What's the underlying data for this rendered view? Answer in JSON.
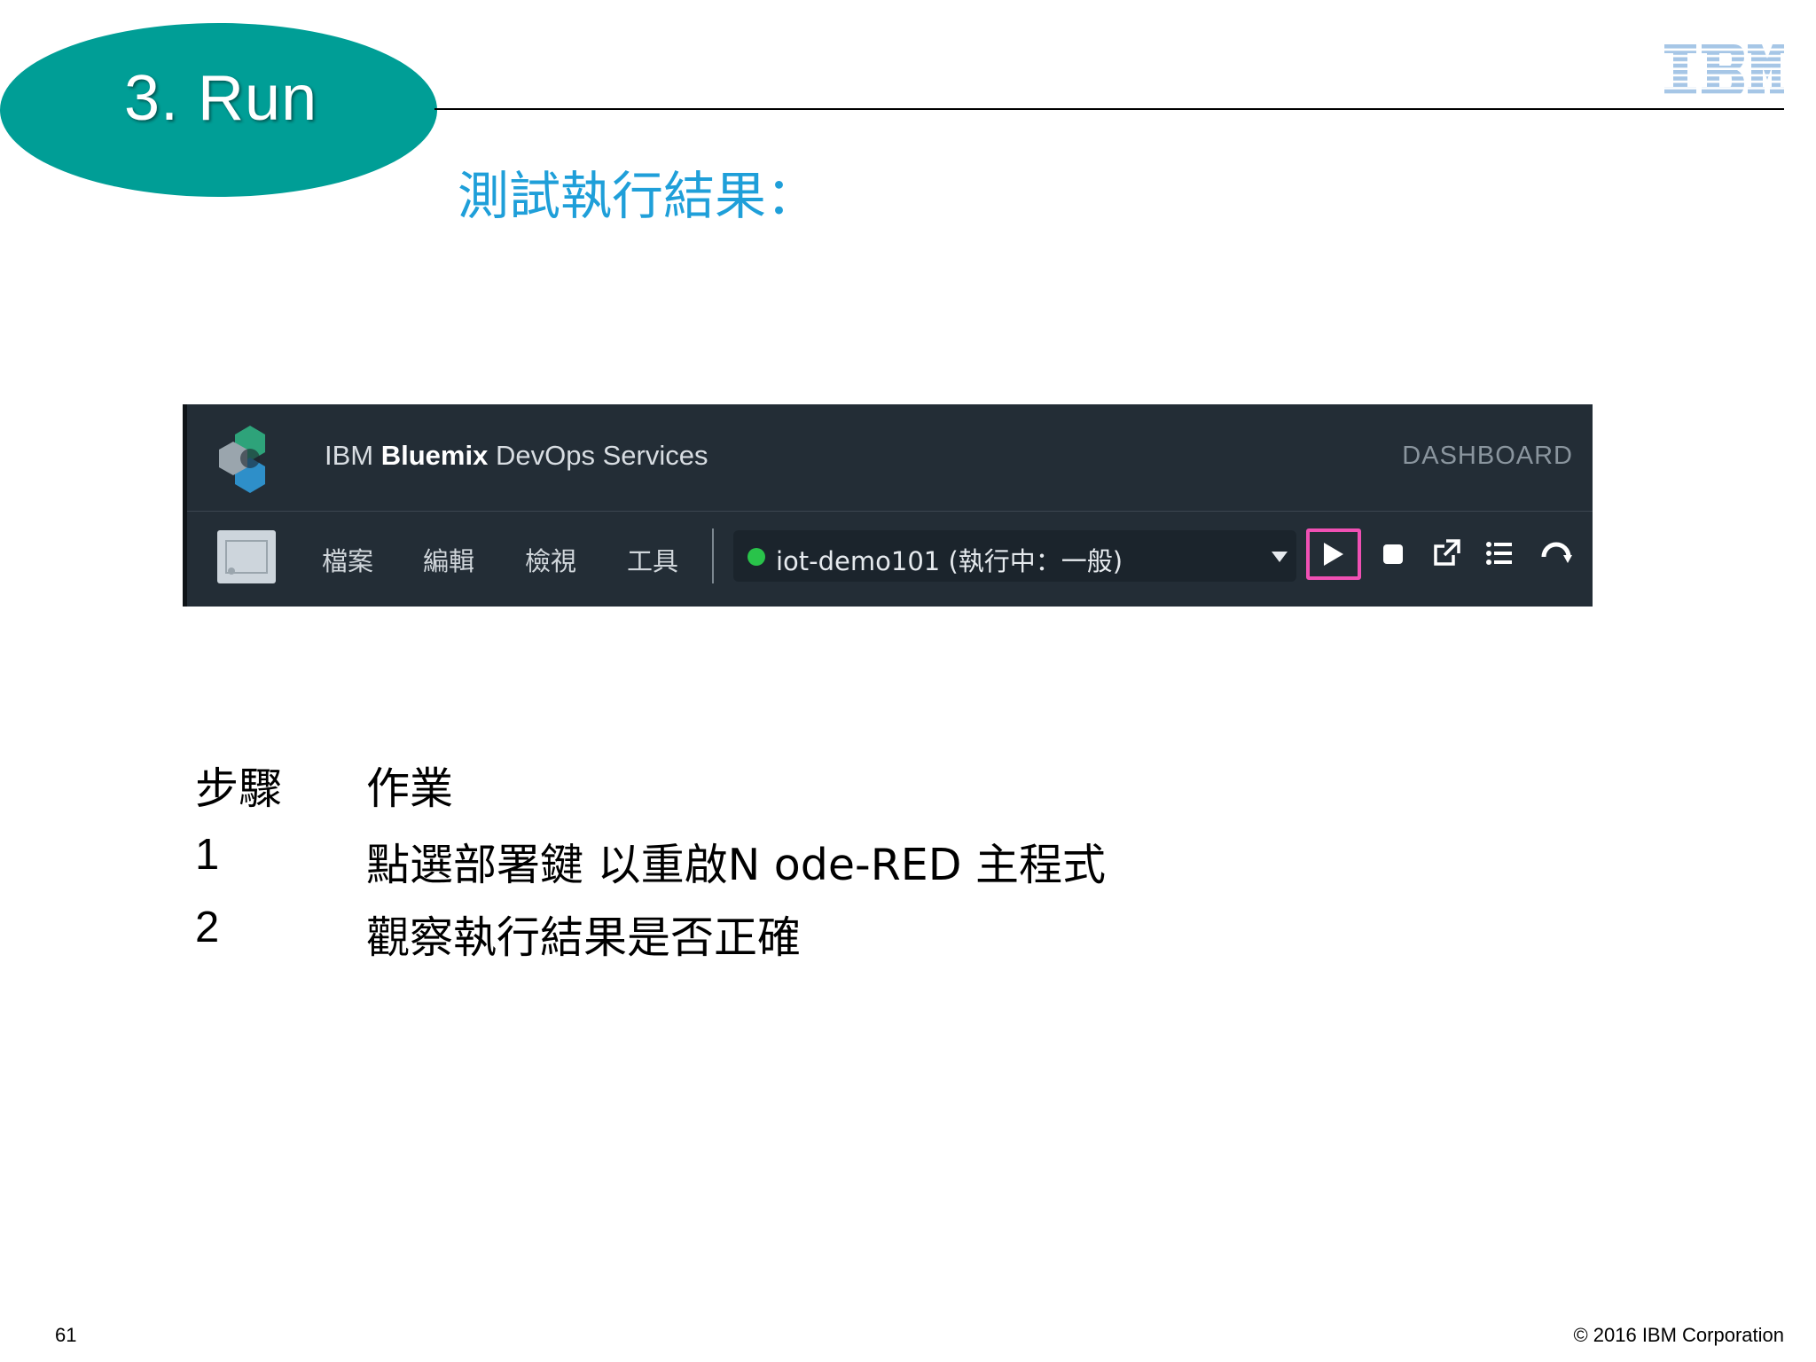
{
  "slide": {
    "title": "3. Run",
    "subtitle": "測試執行結果：",
    "page_number": "61",
    "copyright": "© 2016 IBM Corporation"
  },
  "colors": {
    "title_ellipse": "#009e96",
    "subtitle": "#1f9fd9",
    "ibm_blue": "#1f70c1",
    "toolbar_bg": "#232d36",
    "highlight": "#f050b4",
    "status_green": "#29c34a"
  },
  "logo": {
    "icon": "ibm-logo"
  },
  "screenshot": {
    "brand_prefix": "IBM",
    "brand_bold": "Bluemix",
    "brand_suffix": "DevOps Services",
    "dashboard_label": "DASHBOARD",
    "menu": [
      "檔案",
      "編輯",
      "檢視",
      "工具"
    ],
    "app_selector": "iot-demo101 (執行中：一般)",
    "app_status": "running",
    "icons": [
      "bluemix-logo-icon",
      "project-icon",
      "chevron-down-icon",
      "play-icon",
      "stop-icon",
      "open-external-icon",
      "list-icon",
      "refresh-icon"
    ]
  },
  "steps_table": {
    "header": {
      "step": "步驟",
      "task": "作業"
    },
    "rows": [
      {
        "step": "1",
        "task": "點選部署鍵 以重啟N ode-RED  主程式"
      },
      {
        "step": "2",
        "task": "觀察執行結果是否正確"
      }
    ]
  }
}
